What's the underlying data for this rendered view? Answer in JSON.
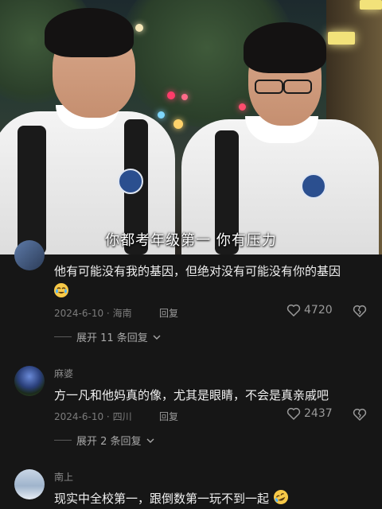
{
  "video": {
    "subtitle": "你都考年级第一 你有压力"
  },
  "comments": [
    {
      "name": "",
      "text": "他有可能没有我的基因，但绝对没有可能没有你的基因",
      "emoji": "crying-laughing-face",
      "date": "2024-6-10",
      "location": "海南",
      "reply_label": "回复",
      "likes": "4720",
      "expand_label": "展开 11 条回复"
    },
    {
      "name": "麻婆",
      "text": "方一凡和他妈真的像，尤其是眼睛，不会是真亲戚吧",
      "date": "2024-6-10",
      "location": "四川",
      "reply_label": "回复",
      "likes": "2437",
      "expand_label": "展开 2 条回复"
    },
    {
      "name": "南上",
      "text": "现实中全校第一，跟倒数第一玩不到一起",
      "emoji": "rolling-laughing-face"
    }
  ],
  "icons": {
    "like": "heart-outline-icon",
    "dislike": "broken-heart-icon",
    "expand": "chevron-down-icon"
  },
  "colors": {
    "background": "#161616",
    "text": "#f0f0f0",
    "muted": "#7c7c7c"
  }
}
